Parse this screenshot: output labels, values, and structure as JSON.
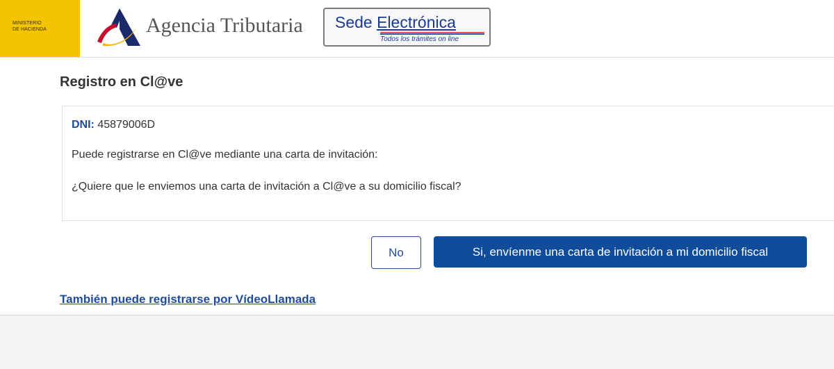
{
  "header": {
    "ministerio_lines": [
      "MINISTERIO",
      "DE HACIENDA"
    ],
    "agency_name": "Agencia Tributaria",
    "agency_logo_icon": "aeat-logo-icon",
    "sede": {
      "title_plain": "Sede ",
      "title_underlined": "Electrónica",
      "subtitle": "Todos los trámites on line"
    }
  },
  "page": {
    "title": "Registro en Cl@ve"
  },
  "card": {
    "dni_label": "DNI:",
    "dni_value": "45879006D",
    "line1": "Puede registrarse en Cl@ve mediante una carta de invitación:",
    "line2": "¿Quiere que le enviemos una carta de invitación a Cl@ve a su domicilio fiscal?"
  },
  "actions": {
    "no_label": "No",
    "yes_label": "Si, envíenme una carta de invitación a mi domicilio fiscal"
  },
  "links": {
    "video_label": "También puede registrarse por VídeoLlamada"
  },
  "colors": {
    "ministerio_yellow": "#f5c400",
    "primary_blue": "#0f4d9c",
    "link_blue": "#1e4b9a",
    "aeat_red": "#c8102e",
    "aeat_gold": "#f2b705",
    "aeat_navy": "#1b2a6b"
  }
}
